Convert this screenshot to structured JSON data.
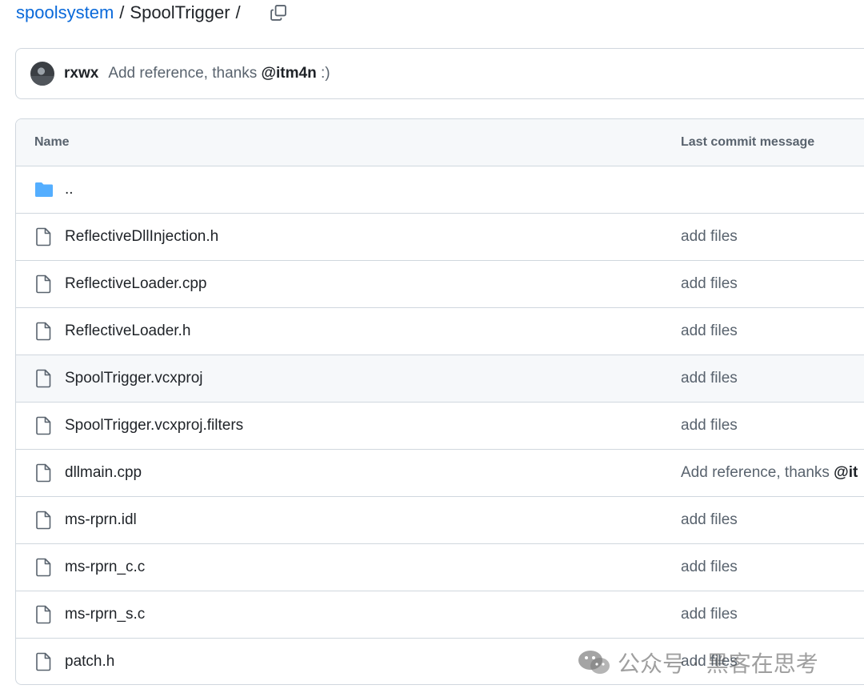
{
  "breadcrumb": {
    "repo": "spoolsystem",
    "separator": "/",
    "folder": "SpoolTrigger",
    "trailing_separator": "/",
    "copy_icon": "copy-icon"
  },
  "latest_commit": {
    "author": "rxwx",
    "message": "Add reference, thanks",
    "mention": "@itm4n",
    "suffix": ":)"
  },
  "table": {
    "headers": {
      "name": "Name",
      "message": "Last commit message"
    },
    "parent_dir": {
      "name": "..",
      "icon": "folder-icon"
    },
    "rows": [
      {
        "name": "ReflectiveDllInjection.h",
        "message": "add files",
        "mention": ""
      },
      {
        "name": "ReflectiveLoader.cpp",
        "message": "add files",
        "mention": ""
      },
      {
        "name": "ReflectiveLoader.h",
        "message": "add files",
        "mention": ""
      },
      {
        "name": "SpoolTrigger.vcxproj",
        "message": "add files",
        "mention": ""
      },
      {
        "name": "SpoolTrigger.vcxproj.filters",
        "message": "add files",
        "mention": ""
      },
      {
        "name": "dllmain.cpp",
        "message": "Add reference, thanks ",
        "mention": "@it"
      },
      {
        "name": "ms-rprn.idl",
        "message": "add files",
        "mention": ""
      },
      {
        "name": "ms-rprn_c.c",
        "message": "add files",
        "mention": ""
      },
      {
        "name": "ms-rprn_s.c",
        "message": "add files",
        "mention": ""
      },
      {
        "name": "patch.h",
        "message": "add files",
        "mention": ""
      }
    ]
  },
  "watermark": {
    "text": "公众号 · 黑客在思考",
    "icon": "wechat-icon"
  },
  "colors": {
    "link": "#0969da",
    "folder": "#54aeff",
    "muted": "#59636e",
    "border": "#d0d7de",
    "header_bg": "#f6f8fa"
  }
}
